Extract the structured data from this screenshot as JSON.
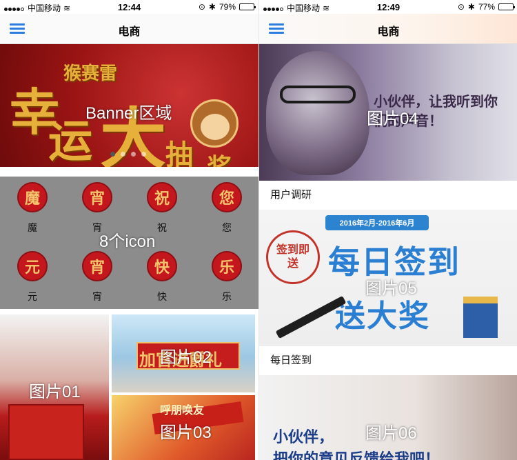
{
  "left": {
    "status": {
      "carrier": "中国移动",
      "time": "12:44",
      "battery": "79%",
      "battery_level": 0.79
    },
    "nav": {
      "title": "电商"
    },
    "banner": {
      "label": "Banner区域",
      "art_text": [
        "猴赛雷",
        "幸",
        "运",
        "大",
        "抽",
        "奖"
      ],
      "page_count": 4,
      "active_page": 0
    },
    "icons": {
      "label": "8个icon",
      "items": [
        {
          "glyph": "魔",
          "label": "魔"
        },
        {
          "glyph": "宵",
          "label": "宵"
        },
        {
          "glyph": "祝",
          "label": "祝"
        },
        {
          "glyph": "您",
          "label": "您"
        },
        {
          "glyph": "元",
          "label": "元"
        },
        {
          "glyph": "宵",
          "label": "宵"
        },
        {
          "glyph": "快",
          "label": "快"
        },
        {
          "glyph": "乐",
          "label": "乐"
        }
      ]
    },
    "tiles": {
      "t01": "图片01",
      "t02": "图片02",
      "t02_art": "加官进爵礼",
      "t03": "图片03",
      "t03_art": "呼朋唤友"
    }
  },
  "right": {
    "status": {
      "carrier": "中国移动",
      "time": "12:49",
      "battery": "77%",
      "battery_level": 0.77
    },
    "nav": {
      "title": "电商"
    },
    "cards": [
      {
        "image_label": "图片04",
        "art_text": "小伙伴，让我听到你们的声音！",
        "caption": "用户调研"
      },
      {
        "image_label": "图片05",
        "art_text_top": "2016年2月-2016年6月",
        "art_text_1": "每日签到",
        "art_text_2": "送大奖",
        "stamp": "签到即送",
        "caption": "每日签到"
      },
      {
        "image_label": "图片06",
        "art_text_1": "小伙伴，",
        "art_text_2": "把你的意见反馈给我吧！"
      }
    ]
  },
  "colors": {
    "accent": "#2b7de0",
    "banner_red": "#9b1414",
    "icon_red": "#c4171d",
    "gold": "#e7b03a"
  }
}
